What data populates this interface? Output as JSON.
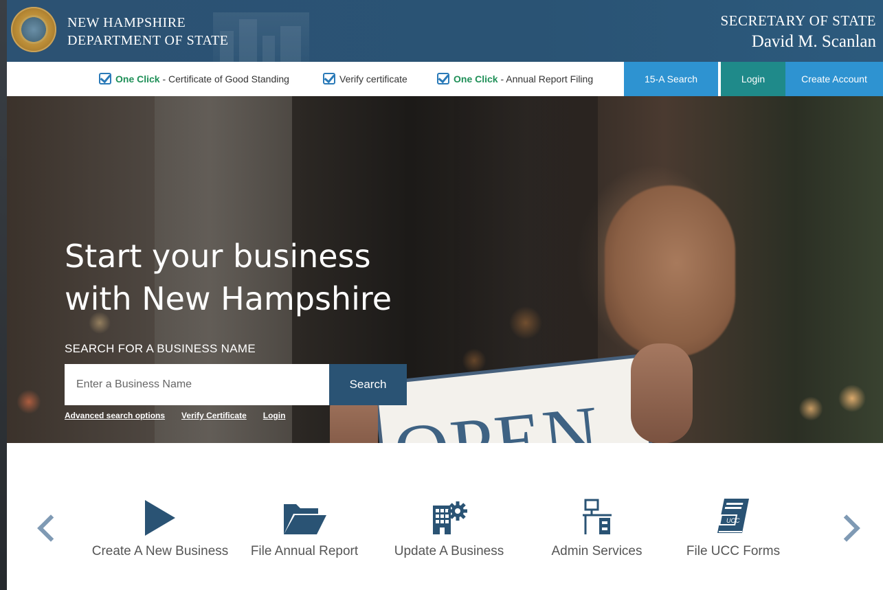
{
  "header": {
    "department_line1": "NEW HAMPSHIRE",
    "department_line2": "DEPARTMENT OF STATE",
    "office_title": "SECRETARY OF STATE",
    "office_holder": "David M. Scanlan",
    "seal": "state-seal-icon"
  },
  "quick_links": [
    {
      "strong": "One Click",
      "text": " - Certificate of Good Standing"
    },
    {
      "strong": "",
      "text": "Verify certificate"
    },
    {
      "strong": "One Click",
      "text": " - Annual Report Filing"
    }
  ],
  "nav_buttons": {
    "search_15a": "15-A Search",
    "login": "Login",
    "create_account": "Create Account"
  },
  "hero": {
    "title_line1": "Start your business",
    "title_line2": "with New Hampshire",
    "search_label": "SEARCH FOR A BUSINESS NAME",
    "search_placeholder": "Enter a Business Name",
    "search_button": "Search",
    "links": [
      "Advanced search options",
      "Verify Certificate",
      "Login"
    ],
    "sign_text": "OPEN"
  },
  "services": [
    {
      "label": "Create A New Business",
      "icon": "play-icon"
    },
    {
      "label": "File Annual Report",
      "icon": "folder-open-icon"
    },
    {
      "label": "Update A Business",
      "icon": "building-gear-icon"
    },
    {
      "label": "Admin Services",
      "icon": "workstation-icon"
    },
    {
      "label": "File UCC Forms",
      "icon": "ucc-book-icon"
    }
  ],
  "colors": {
    "header_bg": "#2a5374",
    "accent_blue": "#2a7ab8",
    "nav_15a_bg": "#2e93d1",
    "nav_login_bg": "#1f8a8a",
    "nav_create_bg": "#2e93d1",
    "green_text": "#1e8f57",
    "icon_blue": "#2a5374"
  }
}
